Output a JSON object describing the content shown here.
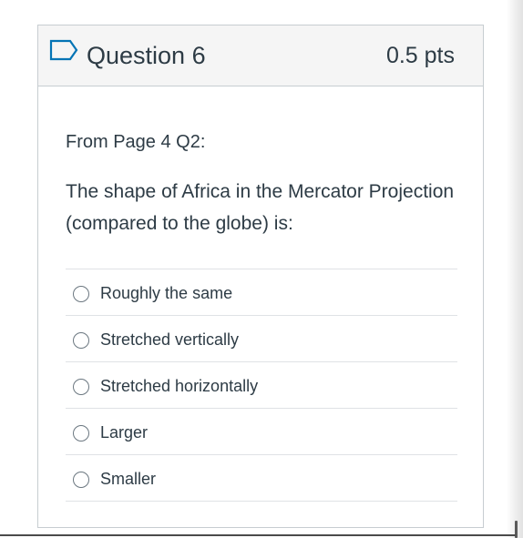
{
  "question": {
    "title": "Question 6",
    "points": "0.5 pts",
    "flag_icon": "bookmark-flag-icon",
    "source": "From Page 4 Q2:",
    "text": "The shape of Africa in the Mercator Projection (compared to the globe) is:",
    "answers": [
      {
        "label": "Roughly the same"
      },
      {
        "label": "Stretched vertically"
      },
      {
        "label": "Stretched horizontally"
      },
      {
        "label": "Larger"
      },
      {
        "label": "Smaller"
      }
    ]
  },
  "colors": {
    "text": "#2d3b45",
    "header_background": "#f5f5f5",
    "border": "#c7cdd1",
    "divider": "#dfe2e5",
    "flag": "#0374b5"
  }
}
